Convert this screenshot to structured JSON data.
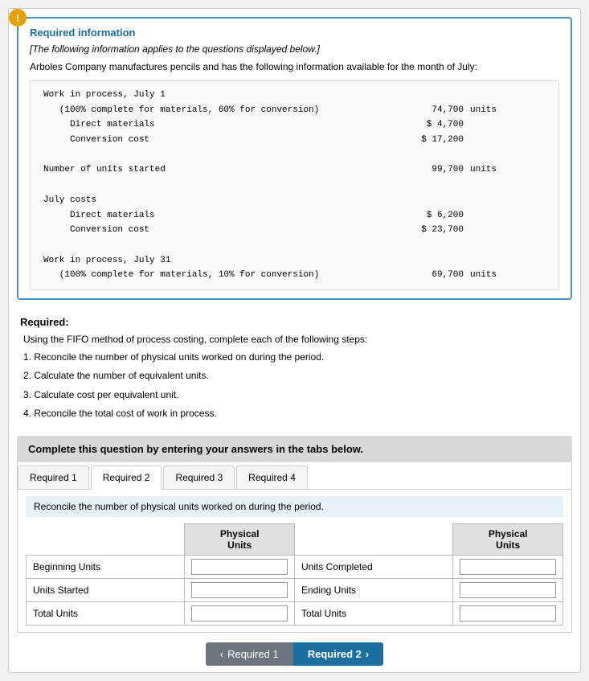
{
  "info": {
    "icon": "!",
    "title": "Required information",
    "italic_note": "[The following information applies to the questions displayed below.]",
    "company_desc": "Arboles Company manufactures pencils and has the following information available for the month of July:",
    "data_rows": [
      {
        "label": "Work in process, July 1",
        "value": "",
        "unit": ""
      },
      {
        "label": "    (100% complete for materials, 60% for conversion)",
        "value": "74,700",
        "unit": "units"
      },
      {
        "label": "    Direct materials",
        "value": "$ 4,700",
        "unit": ""
      },
      {
        "label": "    Conversion cost",
        "value": "$ 17,200",
        "unit": ""
      },
      {
        "label": "",
        "value": "",
        "unit": ""
      },
      {
        "label": "Number of units started",
        "value": "99,700",
        "unit": "units"
      },
      {
        "label": "",
        "value": "",
        "unit": ""
      },
      {
        "label": "July costs",
        "value": "",
        "unit": ""
      },
      {
        "label": "    Direct materials",
        "value": "$ 6,200",
        "unit": ""
      },
      {
        "label": "    Conversion cost",
        "value": "$ 23,700",
        "unit": ""
      },
      {
        "label": "",
        "value": "",
        "unit": ""
      },
      {
        "label": "Work in process, July 31",
        "value": "",
        "unit": ""
      },
      {
        "label": "    (100% complete for materials, 10% for conversion)",
        "value": "69,700",
        "unit": "units"
      }
    ]
  },
  "required": {
    "heading": "Required:",
    "intro": "Using the FIFO method of process costing, complete each of the following steps:",
    "steps": [
      "1. Reconcile the number of physical units worked on during the period.",
      "2. Calculate the number of equivalent units.",
      "3. Calculate cost per equivalent unit.",
      "4. Reconcile the total cost of work in process."
    ]
  },
  "complete_banner": "Complete this question by entering your answers in the tabs below.",
  "tabs": [
    {
      "label": "Required 1",
      "active": false
    },
    {
      "label": "Required 2",
      "active": true
    },
    {
      "label": "Required 3",
      "active": false
    },
    {
      "label": "Required 4",
      "active": false
    }
  ],
  "reconcile_note": "Reconcile the number of physical units worked on during the period.",
  "table": {
    "col_header_left": "Physical\nUnits",
    "col_header_right": "Physical\nUnits",
    "rows_left": [
      {
        "label": "Beginning Units",
        "value": ""
      },
      {
        "label": "Units Started",
        "value": ""
      },
      {
        "label": "Total Units",
        "value": ""
      }
    ],
    "rows_right": [
      {
        "label": "Units Completed",
        "value": ""
      },
      {
        "label": "Ending Units",
        "value": ""
      },
      {
        "label": "Total Units",
        "value": ""
      }
    ]
  },
  "nav": {
    "prev_label": "Required 1",
    "next_label": "Required 2"
  }
}
